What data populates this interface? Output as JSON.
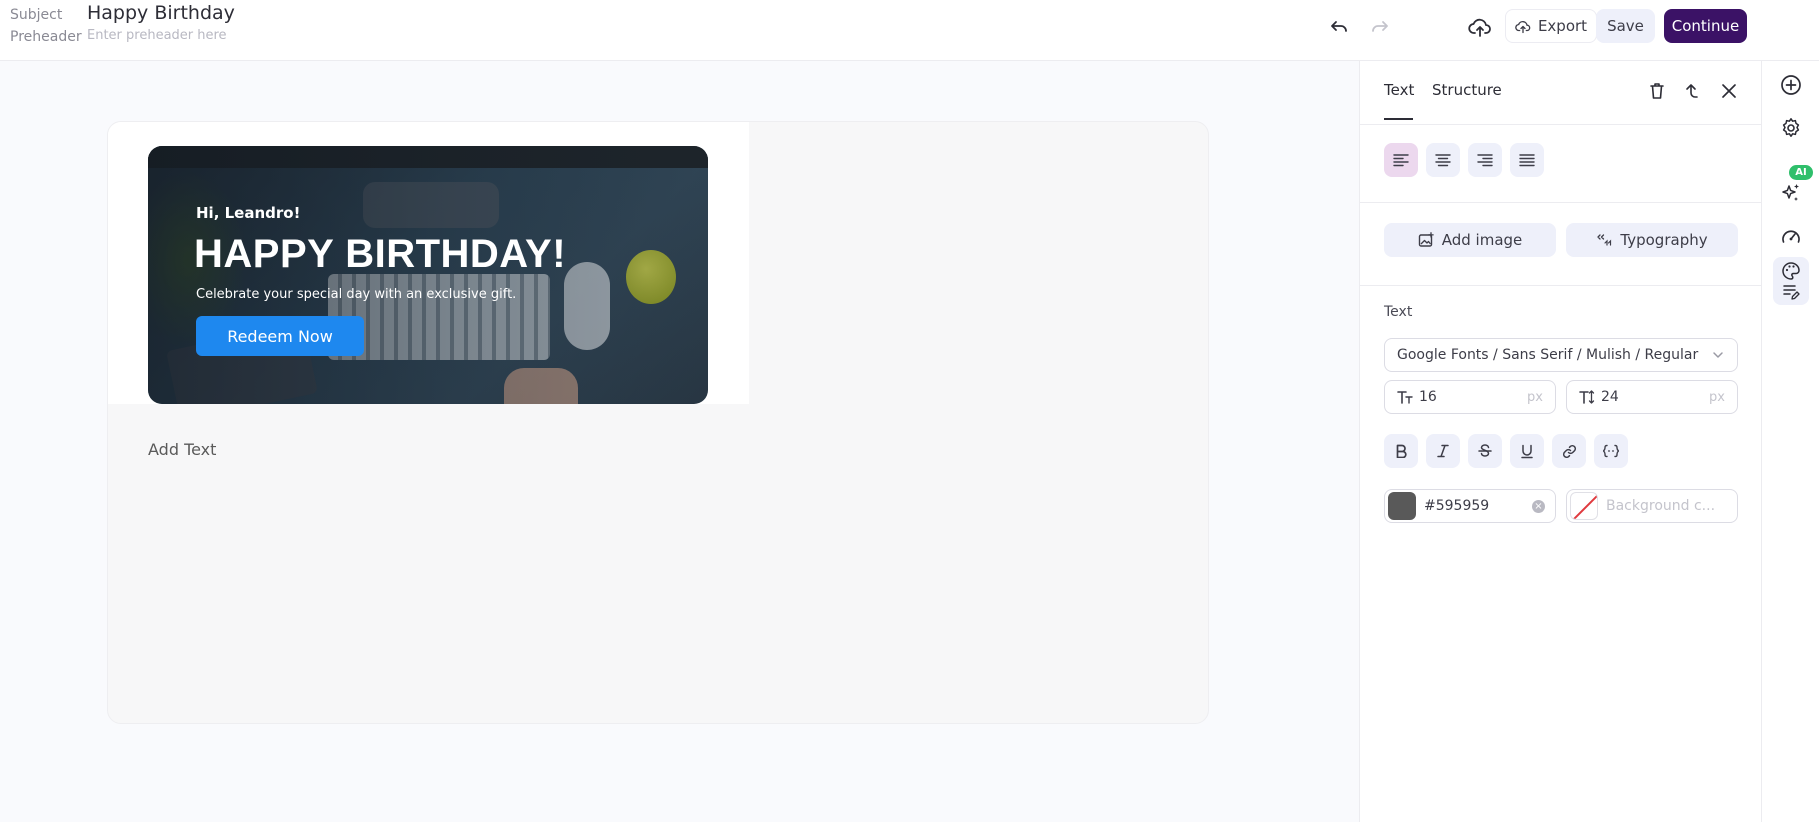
{
  "header": {
    "subject_label": "Subject",
    "subject_value": "Happy Birthday",
    "preheader_label": "Preheader",
    "preheader_placeholder": "Enter preheader here",
    "export_label": "Export",
    "save_label": "Save",
    "continue_label": "Continue",
    "icons": [
      "undo-icon",
      "redo-icon",
      "cloud-upload-icon"
    ]
  },
  "email": {
    "greeting": "Hi, Leandro!",
    "title": "HAPPY BIRTHDAY!",
    "subtitle": "Celebrate your special day with an exclusive gift.",
    "cta_label": "Redeem Now",
    "cta_color": "#1e88ef",
    "add_text": "Add Text"
  },
  "panel": {
    "tabs": [
      {
        "label": "Text",
        "active": true
      },
      {
        "label": "Structure",
        "active": false
      }
    ],
    "alignment_options": [
      "align-left",
      "align-center",
      "align-right",
      "align-justify"
    ],
    "active_alignment": "align-left",
    "add_image_label": "Add image",
    "typography_label": "Typography",
    "section_label": "Text",
    "font": "Google Fonts / Sans Serif / Mulish / Regular",
    "font_size": "16",
    "line_height": "24",
    "unit": "px",
    "format_options": [
      "bold",
      "italic",
      "strikethrough",
      "underline",
      "link",
      "merge-tag"
    ],
    "text_color": "#595959",
    "background_placeholder": "Background c..."
  },
  "rail": {
    "ai_badge": "AI",
    "items": [
      "add-icon",
      "settings-icon",
      "ai-sparkle-icon",
      "speed-icon",
      "palette-icon",
      "text-style-icon"
    ]
  },
  "colors": {
    "brand": "#3b1266",
    "accent": "#1e88ef",
    "ai_badge": "#2fbf6b"
  }
}
